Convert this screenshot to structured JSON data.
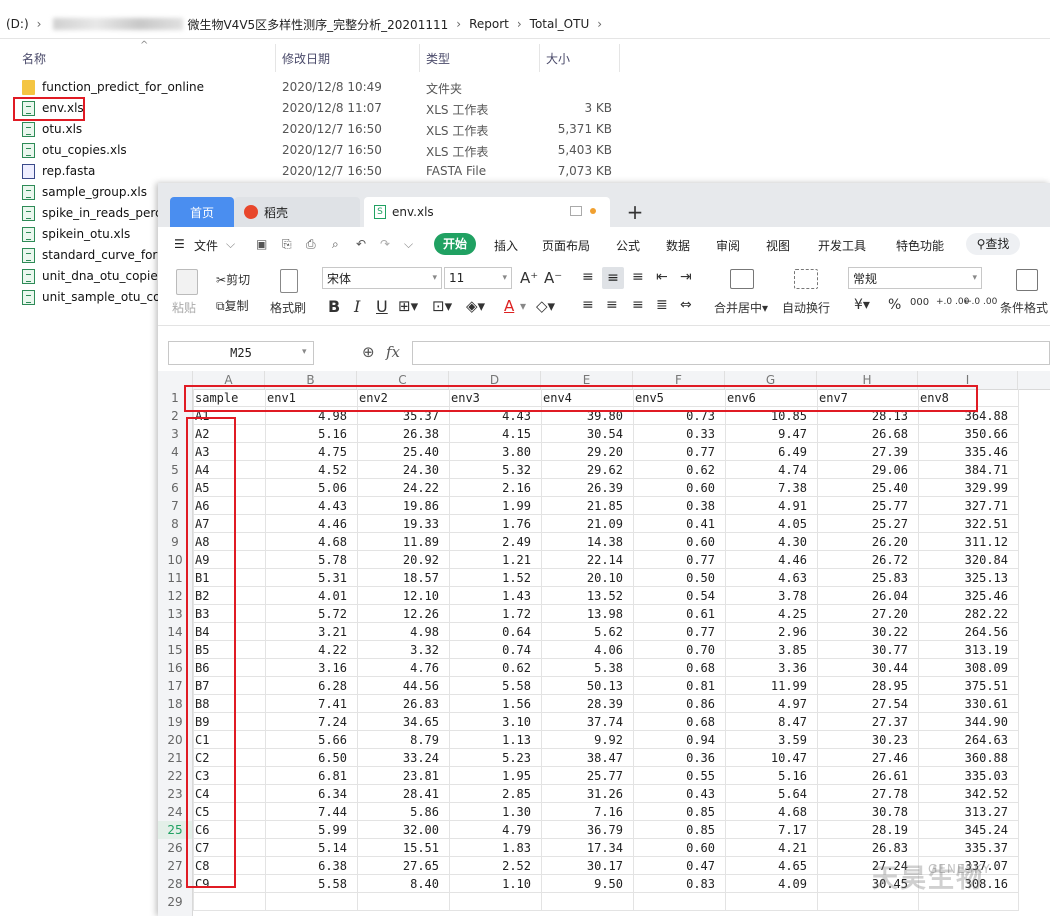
{
  "explorer": {
    "breadcrumb": {
      "drive": "(D:)",
      "folder": "微生物V4V5区多样性测序_完整分析_20201111",
      "sub1": "Report",
      "sub2": "Total_OTU"
    },
    "columns": {
      "name": "名称",
      "date": "修改日期",
      "type": "类型",
      "size": "大小"
    },
    "files": [
      {
        "name": "function_predict_for_online",
        "date": "2020/12/8 10:49",
        "type": "文件夹",
        "size": "",
        "icon": "folder-icon"
      },
      {
        "name": "env.xls",
        "date": "2020/12/8 11:07",
        "type": "XLS 工作表",
        "size": "3 KB",
        "icon": "xls-file-icon"
      },
      {
        "name": "otu.xls",
        "date": "2020/12/7 16:50",
        "type": "XLS 工作表",
        "size": "5,371 KB",
        "icon": "xls-file-icon"
      },
      {
        "name": "otu_copies.xls",
        "date": "2020/12/7 16:50",
        "type": "XLS 工作表",
        "size": "5,403 KB",
        "icon": "xls-file-icon"
      },
      {
        "name": "rep.fasta",
        "date": "2020/12/7 16:50",
        "type": "FASTA File",
        "size": "7,073 KB",
        "icon": "fasta-file-icon"
      },
      {
        "name": "sample_group.xls",
        "date": "",
        "type": "",
        "size": "",
        "icon": "xls-file-icon"
      },
      {
        "name": "spike_in_reads_perc",
        "date": "",
        "type": "",
        "size": "",
        "icon": "xls-file-icon"
      },
      {
        "name": "spikein_otu.xls",
        "date": "",
        "type": "",
        "size": "",
        "icon": "xls-file-icon"
      },
      {
        "name": "standard_curve_form",
        "date": "",
        "type": "",
        "size": "",
        "icon": "xls-file-icon"
      },
      {
        "name": "unit_dna_otu_copies.",
        "date": "",
        "type": "",
        "size": "",
        "icon": "xls-file-icon"
      },
      {
        "name": "unit_sample_otu_cop",
        "date": "",
        "type": "",
        "size": "",
        "icon": "xls-file-icon"
      }
    ]
  },
  "wps": {
    "tabs": {
      "home": "首页",
      "daoke": "稻壳",
      "file": "env.xls"
    },
    "menu": {
      "file": "文件",
      "start": "开始",
      "insert": "插入",
      "layout": "页面布局",
      "formula": "公式",
      "data": "数据",
      "review": "审阅",
      "view": "视图",
      "devtools": "开发工具",
      "features": "特色功能",
      "find": "查找"
    },
    "toolbar": {
      "paste": "粘贴",
      "cut": "剪切",
      "copy": "复制",
      "format_painter": "格式刷",
      "font": "宋体",
      "font_size": "11",
      "merge_center": "合并居中",
      "wrap_text": "自动换行",
      "number_format": "常规",
      "conditional_format": "条件格式",
      "bold": "B",
      "italic": "I",
      "underline": "U",
      "font_color": "A",
      "currency": "¥",
      "percent": "%",
      "thousands": "000",
      "dec_inc": "+.0 .00",
      "dec_dec": "←.0 .00"
    },
    "formula_bar": {
      "name_box": "M25",
      "fx": "fx"
    },
    "col_letters": [
      "A",
      "B",
      "C",
      "D",
      "E",
      "F",
      "G",
      "H",
      "I"
    ],
    "header_row": [
      "sample",
      "env1",
      "env2",
      "env3",
      "env4",
      "env5",
      "env6",
      "env7",
      "env8"
    ],
    "rows": [
      [
        "A1",
        "4.98",
        "35.37",
        "4.43",
        "39.80",
        "0.73",
        "10.85",
        "28.13",
        "364.88"
      ],
      [
        "A2",
        "5.16",
        "26.38",
        "4.15",
        "30.54",
        "0.33",
        "9.47",
        "26.68",
        "350.66"
      ],
      [
        "A3",
        "4.75",
        "25.40",
        "3.80",
        "29.20",
        "0.77",
        "6.49",
        "27.39",
        "335.46"
      ],
      [
        "A4",
        "4.52",
        "24.30",
        "5.32",
        "29.62",
        "0.62",
        "4.74",
        "29.06",
        "384.71"
      ],
      [
        "A5",
        "5.06",
        "24.22",
        "2.16",
        "26.39",
        "0.60",
        "7.38",
        "25.40",
        "329.99"
      ],
      [
        "A6",
        "4.43",
        "19.86",
        "1.99",
        "21.85",
        "0.38",
        "4.91",
        "25.77",
        "327.71"
      ],
      [
        "A7",
        "4.46",
        "19.33",
        "1.76",
        "21.09",
        "0.41",
        "4.05",
        "25.27",
        "322.51"
      ],
      [
        "A8",
        "4.68",
        "11.89",
        "2.49",
        "14.38",
        "0.60",
        "4.30",
        "26.20",
        "311.12"
      ],
      [
        "A9",
        "5.78",
        "20.92",
        "1.21",
        "22.14",
        "0.77",
        "4.46",
        "26.72",
        "320.84"
      ],
      [
        "B1",
        "5.31",
        "18.57",
        "1.52",
        "20.10",
        "0.50",
        "4.63",
        "25.83",
        "325.13"
      ],
      [
        "B2",
        "4.01",
        "12.10",
        "1.43",
        "13.52",
        "0.54",
        "3.78",
        "26.04",
        "325.46"
      ],
      [
        "B3",
        "5.72",
        "12.26",
        "1.72",
        "13.98",
        "0.61",
        "4.25",
        "27.20",
        "282.22"
      ],
      [
        "B4",
        "3.21",
        "4.98",
        "0.64",
        "5.62",
        "0.77",
        "2.96",
        "30.22",
        "264.56"
      ],
      [
        "B5",
        "4.22",
        "3.32",
        "0.74",
        "4.06",
        "0.70",
        "3.85",
        "30.77",
        "313.19"
      ],
      [
        "B6",
        "3.16",
        "4.76",
        "0.62",
        "5.38",
        "0.68",
        "3.36",
        "30.44",
        "308.09"
      ],
      [
        "B7",
        "6.28",
        "44.56",
        "5.58",
        "50.13",
        "0.81",
        "11.99",
        "28.95",
        "375.51"
      ],
      [
        "B8",
        "7.41",
        "26.83",
        "1.56",
        "28.39",
        "0.86",
        "4.97",
        "27.54",
        "330.61"
      ],
      [
        "B9",
        "7.24",
        "34.65",
        "3.10",
        "37.74",
        "0.68",
        "8.47",
        "27.37",
        "344.90"
      ],
      [
        "C1",
        "5.66",
        "8.79",
        "1.13",
        "9.92",
        "0.94",
        "3.59",
        "30.23",
        "264.63"
      ],
      [
        "C2",
        "6.50",
        "33.24",
        "5.23",
        "38.47",
        "0.36",
        "10.47",
        "27.46",
        "360.88"
      ],
      [
        "C3",
        "6.81",
        "23.81",
        "1.95",
        "25.77",
        "0.55",
        "5.16",
        "26.61",
        "335.03"
      ],
      [
        "C4",
        "6.34",
        "28.41",
        "2.85",
        "31.26",
        "0.43",
        "5.64",
        "27.78",
        "342.52"
      ],
      [
        "C5",
        "7.44",
        "5.86",
        "1.30",
        "7.16",
        "0.85",
        "4.68",
        "30.78",
        "313.27"
      ],
      [
        "C6",
        "5.99",
        "32.00",
        "4.79",
        "36.79",
        "0.85",
        "7.17",
        "28.19",
        "345.24"
      ],
      [
        "C7",
        "5.14",
        "15.51",
        "1.83",
        "17.34",
        "0.60",
        "4.21",
        "26.83",
        "335.37"
      ],
      [
        "C8",
        "6.38",
        "27.65",
        "2.52",
        "30.17",
        "0.47",
        "4.65",
        "27.24",
        "337.07"
      ],
      [
        "C9",
        "5.58",
        "8.40",
        "1.10",
        "9.50",
        "0.83",
        "4.09",
        "30.45",
        "308.16"
      ]
    ],
    "watermark": {
      "main": "天昊生物",
      "sub": "GENESKY"
    },
    "colors": {
      "accent_green": "#20a162",
      "tab_blue": "#4a8ef0",
      "annotation_red": "#e01b24"
    }
  }
}
